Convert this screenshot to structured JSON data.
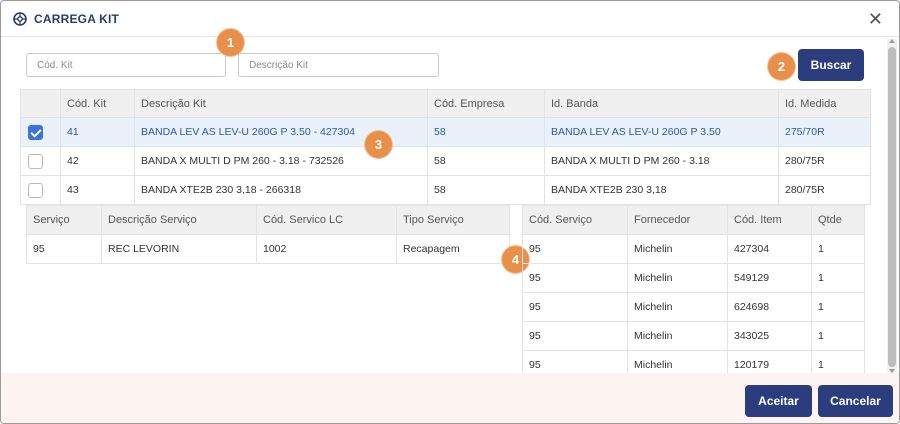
{
  "dialog": {
    "title": "CARREGA KIT",
    "close": "✕"
  },
  "filters": {
    "cod_kit_placeholder": "Cód. Kit",
    "descricao_placeholder": "Descrição Kit",
    "buscar": "Buscar"
  },
  "badges": [
    "1",
    "2",
    "3",
    "4"
  ],
  "kits": {
    "headers": [
      "",
      "Cód. Kit",
      "Descrição Kit",
      "Cód. Empresa",
      "Id. Banda",
      "Id. Medida"
    ],
    "rows": [
      {
        "selected": true,
        "cod": "41",
        "descricao": "BANDA LEV AS LEV-U 260G P 3.50 - 427304",
        "empresa": "58",
        "banda": "BANDA LEV AS LEV-U 260G P 3.50",
        "medida": "275/70R"
      },
      {
        "selected": false,
        "cod": "42",
        "descricao": "BANDA X MULTI D PM 260 - 3.18 - 732526",
        "empresa": "58",
        "banda": "BANDA X MULTI D PM 260 - 3.18",
        "medida": "280/75R"
      },
      {
        "selected": false,
        "cod": "43",
        "descricao": "BANDA XTE2B 230 3,18 - 266318",
        "empresa": "58",
        "banda": "BANDA XTE2B 230 3,18",
        "medida": "280/75R"
      }
    ]
  },
  "servicos": {
    "headers": [
      "Serviço",
      "Descrição Serviço",
      "Cód. Servico LC",
      "Tipo Serviço"
    ],
    "rows": [
      {
        "servico": "95",
        "descricao": "REC LEVORIN",
        "cod_lc": "1002",
        "tipo": "Recapagem"
      }
    ]
  },
  "itens": {
    "headers": [
      "Cód. Serviço",
      "Fornecedor",
      "Cód. Item",
      "Qtde"
    ],
    "rows": [
      {
        "servico": "95",
        "fornecedor": "Michelin",
        "item": "427304",
        "qtde": "1"
      },
      {
        "servico": "95",
        "fornecedor": "Michelin",
        "item": "549129",
        "qtde": "1"
      },
      {
        "servico": "95",
        "fornecedor": "Michelin",
        "item": "624698",
        "qtde": "1"
      },
      {
        "servico": "95",
        "fornecedor": "Michelin",
        "item": "343025",
        "qtde": "1"
      },
      {
        "servico": "95",
        "fornecedor": "Michelin",
        "item": "120179",
        "qtde": "1"
      }
    ]
  },
  "footer": {
    "aceitar": "Aceitar",
    "cancelar": "Cancelar"
  },
  "colors": {
    "primary": "#2c3d7e",
    "badge": "#e8904a",
    "selected_row": "#e9f1fb",
    "footer_bg": "#fdf4f2"
  }
}
